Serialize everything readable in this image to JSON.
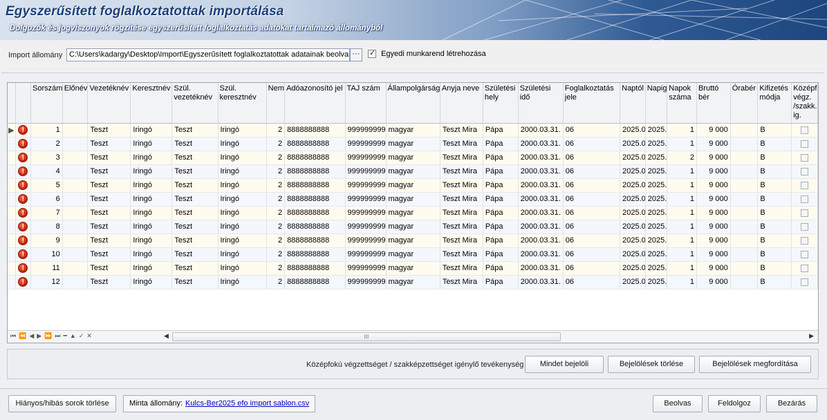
{
  "header": {
    "title": "Egyszerűsített foglalkoztatottak importálása",
    "subtitle": "Dolgozók és jogviszonyok rögzítése egyszerűsített foglalkoztatás adatokat tartalmazó állományból"
  },
  "import": {
    "label": "Import állomány",
    "path": "C:\\Users\\kadargy\\Desktop\\Import\\Egyszerűsített foglalkoztatottak adatainak beolvasása",
    "browse_label": "···",
    "egyedi_label": "Egyedi munkarend létrehozása",
    "egyedi_checked": true
  },
  "grid": {
    "columns": [
      "",
      "",
      "Sorszám",
      "Előnév",
      "Vezetéknév",
      "Keresztnév",
      "Szül. vezetéknév",
      "Szül. keresztnév",
      "Nem",
      "Adóazonosító jel",
      "TAJ szám",
      "Állampolgárság",
      "Anyja neve",
      "Születési hely",
      "Születési idő",
      "Foglalkoztatás jele",
      "Naptól",
      "Napig",
      "Napok száma",
      "Bruttó bér",
      "Órabér",
      "Kifizetés módja",
      "Középf. végz. /szakk. ig."
    ],
    "rows": [
      {
        "sorszam": "1",
        "elonev": "",
        "vezeteknev": "Teszt",
        "keresztnev": "Iringó",
        "szul_vezeteknev": "Teszt",
        "szul_keresztnev": "Iringó",
        "nem": "2",
        "adoazonosito": "8888888888",
        "taj": "999999999",
        "allampolgarsag": "magyar",
        "anyja_neve": "Teszt Mira",
        "szul_hely": "Pápa",
        "szul_ido": "2000.03.31.",
        "foglalkoztatas": "06",
        "naptol": "2025.0",
        "napig": "2025.",
        "napok": "1",
        "brutto": "9 000",
        "oraber": "",
        "kifizetes": "B"
      },
      {
        "sorszam": "2",
        "elonev": "",
        "vezeteknev": "Teszt",
        "keresztnev": "Iringó",
        "szul_vezeteknev": "Teszt",
        "szul_keresztnev": "Iringó",
        "nem": "2",
        "adoazonosito": "8888888888",
        "taj": "999999999",
        "allampolgarsag": "magyar",
        "anyja_neve": "Teszt Mira",
        "szul_hely": "Pápa",
        "szul_ido": "2000.03.31.",
        "foglalkoztatas": "06",
        "naptol": "2025.0",
        "napig": "2025.",
        "napok": "1",
        "brutto": "9 000",
        "oraber": "",
        "kifizetes": "B"
      },
      {
        "sorszam": "3",
        "elonev": "",
        "vezeteknev": "Teszt",
        "keresztnev": "Iringó",
        "szul_vezeteknev": "Teszt",
        "szul_keresztnev": "Iringó",
        "nem": "2",
        "adoazonosito": "8888888888",
        "taj": "999999999",
        "allampolgarsag": "magyar",
        "anyja_neve": "Teszt Mira",
        "szul_hely": "Pápa",
        "szul_ido": "2000.03.31.",
        "foglalkoztatas": "06",
        "naptol": "2025.0",
        "napig": "2025.",
        "napok": "2",
        "brutto": "9 000",
        "oraber": "",
        "kifizetes": "B"
      },
      {
        "sorszam": "4",
        "elonev": "",
        "vezeteknev": "Teszt",
        "keresztnev": "Iringó",
        "szul_vezeteknev": "Teszt",
        "szul_keresztnev": "Iringó",
        "nem": "2",
        "adoazonosito": "8888888888",
        "taj": "999999999",
        "allampolgarsag": "magyar",
        "anyja_neve": "Teszt Mira",
        "szul_hely": "Pápa",
        "szul_ido": "2000.03.31.",
        "foglalkoztatas": "06",
        "naptol": "2025.0",
        "napig": "2025.",
        "napok": "1",
        "brutto": "9 000",
        "oraber": "",
        "kifizetes": "B"
      },
      {
        "sorszam": "5",
        "elonev": "",
        "vezeteknev": "Teszt",
        "keresztnev": "Iringó",
        "szul_vezeteknev": "Teszt",
        "szul_keresztnev": "Iringó",
        "nem": "2",
        "adoazonosito": "8888888888",
        "taj": "999999999",
        "allampolgarsag": "magyar",
        "anyja_neve": "Teszt Mira",
        "szul_hely": "Pápa",
        "szul_ido": "2000.03.31.",
        "foglalkoztatas": "06",
        "naptol": "2025.0",
        "napig": "2025.",
        "napok": "1",
        "brutto": "9 000",
        "oraber": "",
        "kifizetes": "B"
      },
      {
        "sorszam": "6",
        "elonev": "",
        "vezeteknev": "Teszt",
        "keresztnev": "Iringó",
        "szul_vezeteknev": "Teszt",
        "szul_keresztnev": "Iringó",
        "nem": "2",
        "adoazonosito": "8888888888",
        "taj": "999999999",
        "allampolgarsag": "magyar",
        "anyja_neve": "Teszt Mira",
        "szul_hely": "Pápa",
        "szul_ido": "2000.03.31.",
        "foglalkoztatas": "06",
        "naptol": "2025.0",
        "napig": "2025.",
        "napok": "1",
        "brutto": "9 000",
        "oraber": "",
        "kifizetes": "B"
      },
      {
        "sorszam": "7",
        "elonev": "",
        "vezeteknev": "Teszt",
        "keresztnev": "Iringó",
        "szul_vezeteknev": "Teszt",
        "szul_keresztnev": "Iringó",
        "nem": "2",
        "adoazonosito": "8888888888",
        "taj": "999999999",
        "allampolgarsag": "magyar",
        "anyja_neve": "Teszt Mira",
        "szul_hely": "Pápa",
        "szul_ido": "2000.03.31.",
        "foglalkoztatas": "06",
        "naptol": "2025.0",
        "napig": "2025.",
        "napok": "1",
        "brutto": "9 000",
        "oraber": "",
        "kifizetes": "B"
      },
      {
        "sorszam": "8",
        "elonev": "",
        "vezeteknev": "Teszt",
        "keresztnev": "Iringó",
        "szul_vezeteknev": "Teszt",
        "szul_keresztnev": "Iringó",
        "nem": "2",
        "adoazonosito": "8888888888",
        "taj": "999999999",
        "allampolgarsag": "magyar",
        "anyja_neve": "Teszt Mira",
        "szul_hely": "Pápa",
        "szul_ido": "2000.03.31.",
        "foglalkoztatas": "06",
        "naptol": "2025.0",
        "napig": "2025.",
        "napok": "1",
        "brutto": "9 000",
        "oraber": "",
        "kifizetes": "B"
      },
      {
        "sorszam": "9",
        "elonev": "",
        "vezeteknev": "Teszt",
        "keresztnev": "Iringó",
        "szul_vezeteknev": "Teszt",
        "szul_keresztnev": "Iringó",
        "nem": "2",
        "adoazonosito": "8888888888",
        "taj": "999999999",
        "allampolgarsag": "magyar",
        "anyja_neve": "Teszt Mira",
        "szul_hely": "Pápa",
        "szul_ido": "2000.03.31.",
        "foglalkoztatas": "06",
        "naptol": "2025.0",
        "napig": "2025.",
        "napok": "1",
        "brutto": "9 000",
        "oraber": "",
        "kifizetes": "B"
      },
      {
        "sorszam": "10",
        "elonev": "",
        "vezeteknev": "Teszt",
        "keresztnev": "Iringó",
        "szul_vezeteknev": "Teszt",
        "szul_keresztnev": "Iringó",
        "nem": "2",
        "adoazonosito": "8888888888",
        "taj": "999999999",
        "allampolgarsag": "magyar",
        "anyja_neve": "Teszt Mira",
        "szul_hely": "Pápa",
        "szul_ido": "2000.03.31.",
        "foglalkoztatas": "06",
        "naptol": "2025.0",
        "napig": "2025.",
        "napok": "1",
        "brutto": "9 000",
        "oraber": "",
        "kifizetes": "B"
      },
      {
        "sorszam": "11",
        "elonev": "",
        "vezeteknev": "Teszt",
        "keresztnev": "Iringó",
        "szul_vezeteknev": "Teszt",
        "szul_keresztnev": "Iringó",
        "nem": "2",
        "adoazonosito": "8888888888",
        "taj": "999999999",
        "allampolgarsag": "magyar",
        "anyja_neve": "Teszt Mira",
        "szul_hely": "Pápa",
        "szul_ido": "2000.03.31.",
        "foglalkoztatas": "06",
        "naptol": "2025.0",
        "napig": "2025.",
        "napok": "1",
        "brutto": "9 000",
        "oraber": "",
        "kifizetes": "B"
      },
      {
        "sorszam": "12",
        "elonev": "",
        "vezeteknev": "Teszt",
        "keresztnev": "Iringó",
        "szul_vezeteknev": "Teszt",
        "szul_keresztnev": "Iringó",
        "nem": "2",
        "adoazonosito": "8888888888",
        "taj": "999999999",
        "allampolgarsag": "magyar",
        "anyja_neve": "Teszt Mira",
        "szul_hely": "Pápa",
        "szul_ido": "2000.03.31.",
        "foglalkoztatas": "06",
        "naptol": "2025.0",
        "napig": "2025.",
        "napok": "1",
        "brutto": "9 000",
        "oraber": "",
        "kifizetes": "B"
      }
    ],
    "row_icon": "error-icon",
    "scroll_thumb_label": "III"
  },
  "marking": {
    "label": "Középfokú végzettséget / szakképzettséget igénylő tevékenység",
    "mark_all": "Mindet bejelöli",
    "clear_marks": "Bejelölések törlése",
    "invert_marks": "Bejelölések megfordítása"
  },
  "footer": {
    "delete_bad_rows": "Hiányos/hibás sorok törlése",
    "template_label": "Minta állomány:",
    "template_link": "Kulcs-Ber2025 efo import sablon.csv",
    "load": "Beolvas",
    "process": "Feldolgoz",
    "close": "Bezárás"
  }
}
